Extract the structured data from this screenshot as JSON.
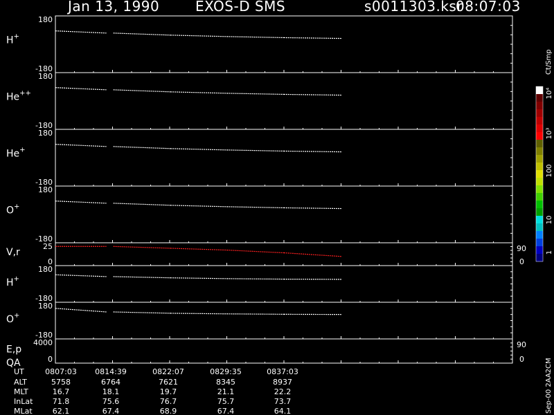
{
  "header": {
    "date": "Jan 13, 1990",
    "instrument": "EXOS-D SMS",
    "file": "s0011303.ksr",
    "time": "08:07:03"
  },
  "colors": {
    "background": "#000000",
    "axis": "#ffffff",
    "trace": "#ffffff",
    "velocity_trace": "#ff2020"
  },
  "colorbar": {
    "unit_label": "Ct/Smp",
    "tick_labels": [
      "1",
      "10",
      "100",
      "10³",
      "10⁴"
    ],
    "colors": [
      "#000080",
      "#0000c0",
      "#0040e0",
      "#0080ff",
      "#00c0c0",
      "#00e0e0",
      "#00a000",
      "#00c000",
      "#40d000",
      "#80e000",
      "#c0e000",
      "#e0e000",
      "#c0c000",
      "#a0a000",
      "#808000",
      "#606000",
      "#ff0000",
      "#e00000",
      "#c00000",
      "#a00000",
      "#800000",
      "#600000",
      "#ffffff"
    ]
  },
  "side_note": "Sep-00  2AA2CM",
  "chart_data": [
    {
      "type": "line",
      "panel": "H+",
      "label_base": "H",
      "label_sup": "+",
      "ytop_label": "180",
      "ybot_label": "-180",
      "ylim": [
        -180,
        180
      ],
      "x_ticks": [
        "0807:03",
        "0814:39",
        "0822:07",
        "0829:35",
        "0837:03"
      ],
      "series": [
        {
          "values": [
            [
              0,
              85
            ],
            [
              7.6,
              71
            ],
            [
              15.1,
              58
            ],
            [
              22.5,
              49
            ],
            [
              30,
              42
            ],
            [
              37.6,
              37
            ]
          ]
        }
      ]
    },
    {
      "type": "line",
      "panel": "He++",
      "label_base": "He",
      "label_sup": "++",
      "ytop_label": "180",
      "ybot_label": "-180",
      "ylim": [
        -180,
        180
      ],
      "series": [
        {
          "values": [
            [
              0,
              85
            ],
            [
              7.6,
              71
            ],
            [
              15.1,
              58
            ],
            [
              22.5,
              49
            ],
            [
              30,
              42
            ],
            [
              37.6,
              37
            ]
          ]
        }
      ]
    },
    {
      "type": "line",
      "panel": "He+",
      "label_base": "He",
      "label_sup": "+",
      "ytop_label": "180",
      "ybot_label": "-180",
      "ylim": [
        -180,
        180
      ],
      "series": [
        {
          "values": [
            [
              0,
              85
            ],
            [
              7.6,
              71
            ],
            [
              15.1,
              58
            ],
            [
              22.5,
              49
            ],
            [
              30,
              42
            ],
            [
              37.6,
              37
            ]
          ]
        }
      ]
    },
    {
      "type": "line",
      "panel": "O+",
      "label_base": "O",
      "label_sup": "+",
      "ytop_label": "180",
      "ybot_label": "-180",
      "ylim": [
        -180,
        180
      ],
      "series": [
        {
          "values": [
            [
              0,
              85
            ],
            [
              7.6,
              71
            ],
            [
              15.1,
              58
            ],
            [
              22.5,
              49
            ],
            [
              30,
              42
            ],
            [
              37.6,
              37
            ]
          ]
        }
      ]
    },
    {
      "type": "line",
      "panel": "V,r",
      "label_base": "V,r",
      "label_sup": "",
      "ytop_label": "25",
      "ybot_label": "0",
      "ylim": [
        0,
        25
      ],
      "right_ticks": [
        "90",
        "0"
      ],
      "series": [
        {
          "values": [
            [
              0,
              21
            ],
            [
              7.6,
              21
            ],
            [
              15.1,
              19
            ],
            [
              22.5,
              17
            ],
            [
              30,
              14
            ],
            [
              37.6,
              10
            ]
          ]
        }
      ]
    },
    {
      "type": "line",
      "panel": "H+ (lower)",
      "label_base": "H",
      "label_sup": "+",
      "ytop_label": "180",
      "ybot_label": "-180",
      "ylim": [
        -180,
        180
      ],
      "series": [
        {
          "values": [
            [
              0,
              90
            ],
            [
              7.6,
              72
            ],
            [
              15.1,
              60
            ],
            [
              22.5,
              52
            ],
            [
              30,
              47
            ],
            [
              37.6,
              45
            ]
          ]
        }
      ]
    },
    {
      "type": "line",
      "panel": "O+ (lower)",
      "label_base": "O",
      "label_sup": "+",
      "ytop_label": "180",
      "ybot_label": "-180",
      "ylim": [
        -180,
        180
      ],
      "series": [
        {
          "values": [
            [
              0,
              120
            ],
            [
              7.6,
              85
            ],
            [
              15.1,
              72
            ],
            [
              22.5,
              66
            ],
            [
              30,
              62
            ],
            [
              37.6,
              60
            ]
          ]
        }
      ]
    },
    {
      "type": "line",
      "panel": "E,p / QA",
      "label_base": "E,p",
      "label_sup": "",
      "label2": "QA",
      "ytop_label": "4000",
      "ybot_label": "0",
      "ylim": [
        0,
        4000
      ],
      "right_ticks": [
        "90",
        "0"
      ],
      "series": []
    }
  ],
  "orbit_table": {
    "row_labels": [
      "UT",
      "ALT",
      "MLT",
      "InLat",
      "MLat"
    ],
    "columns": [
      [
        "0807:03",
        "5758",
        "16.7",
        "71.8",
        "62.1"
      ],
      [
        "0814:39",
        "6764",
        "18.1",
        "75.6",
        "67.4"
      ],
      [
        "0822:07",
        "7621",
        "19.7",
        "76.7",
        "68.9"
      ],
      [
        "0829:35",
        "8345",
        "21.1",
        "75.7",
        "67.4"
      ],
      [
        "0837:03",
        "8937",
        "22.2",
        "73.7",
        "64.1"
      ]
    ]
  }
}
